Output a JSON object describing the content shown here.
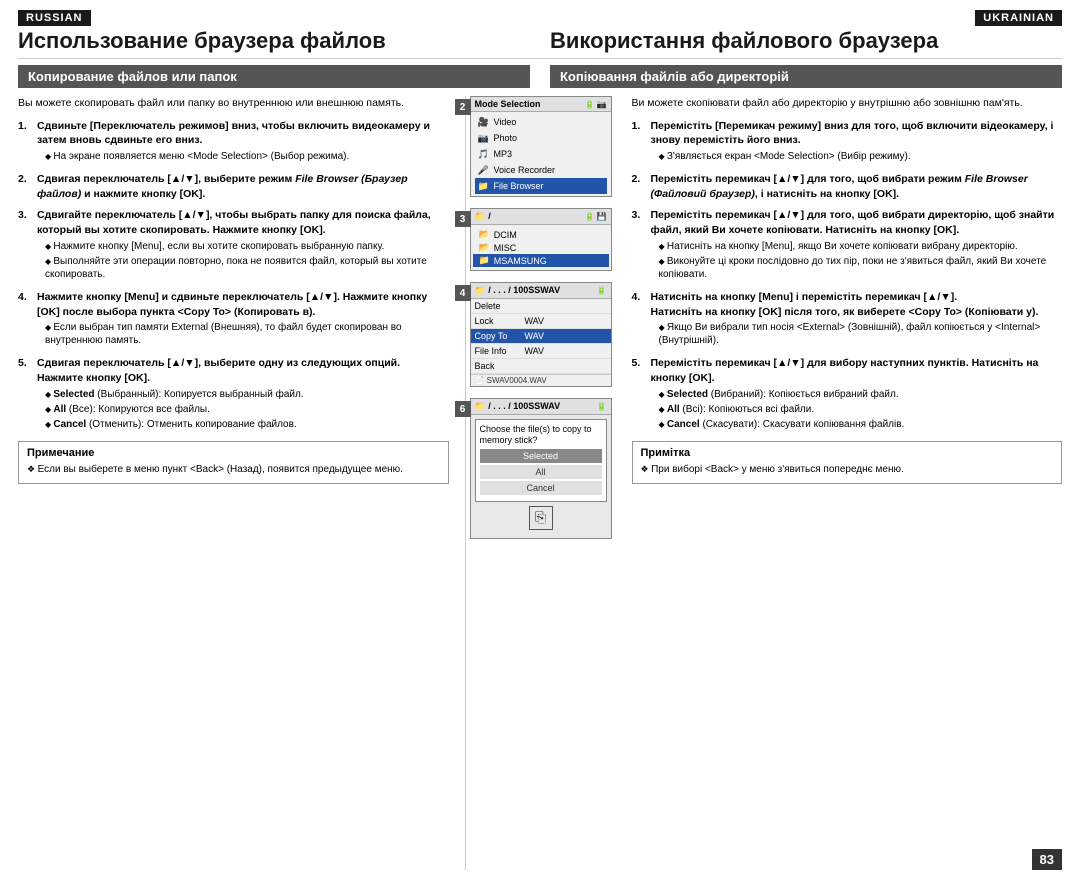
{
  "lang_left": "RUSSIAN",
  "lang_right": "UKRAINIAN",
  "title_left": "Использование браузера файлов",
  "title_right": "Використання файлового браузера",
  "section_left": "Копирование файлов или папок",
  "section_right": "Копіювання файлів або директорій",
  "intro_left": "Вы можете скопировать файл или папку во внутреннюю или внешнюю память.",
  "intro_right": "Ви можете скопіювати файл або директорію у внутрішню або зовнішню пам'ять.",
  "steps_left": [
    {
      "num": "1.",
      "main": "Сдвиньте [Переключатель режимов] вниз, чтобы включить видеокамеру и затем вновь сдвиньте его вниз.",
      "sub": [
        "На экране появляется меню <Mode Selection> (Выбор режима)."
      ]
    },
    {
      "num": "2.",
      "main": "Сдвигая переключатель [▲/▼], выберите режим File Browser (Браузер файлов) и нажмите кнопку [OK].",
      "sub": []
    },
    {
      "num": "3.",
      "main": "Сдвигайте переключатель [▲/▼], чтобы выбрать папку для поиска файла, который вы хотите скопировать. Нажмите кнопку [OK].",
      "sub": [
        "Нажмите кнопку [Menu], если вы хотите скопировать выбранную папку.",
        "Выполняйте эти операции повторно, пока не появится файл, который вы хотите скопировать."
      ]
    },
    {
      "num": "4.",
      "main": "Нажмите кнопку [Menu] и сдвиньте переключатель [▲/▼]. Нажмите кнопку [OK] после выбора пункта <Copy To> (Копировать в).",
      "sub": [
        "Если выбран тип памяти External (Внешняя), то файл будет скопирован во внутреннюю память."
      ]
    },
    {
      "num": "5.",
      "main": "Сдвигая переключатель [▲/▼], выберите одну из следующих опций. Нажмите кнопку [OK].",
      "sub": [
        "Selected (Выбранный): Копируется выбранный файл.",
        "All (Все): Копируются все файлы.",
        "Cancel (Отменить): Отменить копирование файлов."
      ]
    }
  ],
  "note_left_title": "Примечание",
  "note_left_items": [
    "Если вы выберете в меню пункт <Back> (Назад), появится предыдущее меню."
  ],
  "steps_right": [
    {
      "num": "1.",
      "main": "Перемістіть [Перемикач режиму] вниз для того, щоб включити відеокамеру, і знову перемістіть його вниз.",
      "sub": [
        "З'являється екран <Mode Selection> (Вибір режиму)."
      ]
    },
    {
      "num": "2.",
      "main": "Перемістіть перемикач [▲/▼] для того, щоб вибрати режим File Browser (Файловий браузер), і натисніть на кнопку [OK].",
      "sub": []
    },
    {
      "num": "3.",
      "main": "Перемістіть перемикач [▲/▼] для того, щоб вибрати директорію, щоб знайти файл, який Ви хочете копіювати. Натисніть на кнопку [OK].",
      "sub": [
        "Натисніть на кнопку [Menu], якщо Ви хочете копіювати вибрану директорію.",
        "Виконуйте ці кроки послідовно до тих пір, поки не з'явиться файл, який Ви хочете копіювати."
      ]
    },
    {
      "num": "4.",
      "main": "Натисніть на кнопку [Menu] і перемістіть перемикач [▲/▼].\nНатисніть на кнопку [OK] після того, як виберете <Copy To> (Копіювати у).",
      "sub": [
        "Якщо Ви вибрали тип носія <External> (Зовнішній), файл копіюється у <Internal> (Внутрішній)."
      ]
    },
    {
      "num": "5.",
      "main": "Перемістіть перемикач [▲/▼] для вибору наступних пунктів. Натисніть на кнопку [OK].",
      "sub": [
        "Selected (Вибраний): Копіюється вибраний файл.",
        "All (Всі): Копіюються всі файли.",
        "Cancel (Скасувати): Скасувати копіювання файлів."
      ]
    }
  ],
  "note_right_title": "Примітка",
  "note_right_items": [
    "При виборі <Back> у меню з'явиться попереднє меню."
  ],
  "page_num": "83",
  "screens": [
    {
      "num": "2",
      "header": "Mode Selection",
      "items": [
        {
          "icon": "🎥",
          "label": "Video",
          "active": false
        },
        {
          "icon": "📷",
          "label": "Photo",
          "active": false
        },
        {
          "icon": "🎵",
          "label": "MP3",
          "active": false
        },
        {
          "icon": "🎤",
          "label": "Voice Recorder",
          "active": false
        },
        {
          "icon": "📁",
          "label": "File Browser",
          "active": true
        }
      ]
    },
    {
      "num": "3",
      "header": "/",
      "folders": [
        {
          "label": "DCIM",
          "active": false
        },
        {
          "label": "MISC",
          "active": false
        },
        {
          "label": "MSAMSUNG",
          "active": true
        }
      ]
    },
    {
      "num": "4",
      "header": "/ . . . / 100SSWAV",
      "actions": [
        {
          "label": "Delete",
          "value": "",
          "active": false
        },
        {
          "label": "Lock",
          "value": "WAV",
          "active": false
        },
        {
          "label": "Copy To",
          "value": "WAV",
          "active": true
        },
        {
          "label": "File Info",
          "value": "WAV",
          "active": false
        },
        {
          "label": "Back",
          "value": "",
          "active": false
        }
      ],
      "extra": "SWAV0004.WAV"
    },
    {
      "num": "6",
      "header": "/ . . . / 100SSWAV",
      "choose_title": "Choose the file(s) to copy to memory stick?",
      "options": [
        {
          "label": "Selected",
          "type": "selected"
        },
        {
          "label": "All",
          "type": "plain"
        },
        {
          "label": "Cancel",
          "type": "plain"
        }
      ]
    }
  ]
}
